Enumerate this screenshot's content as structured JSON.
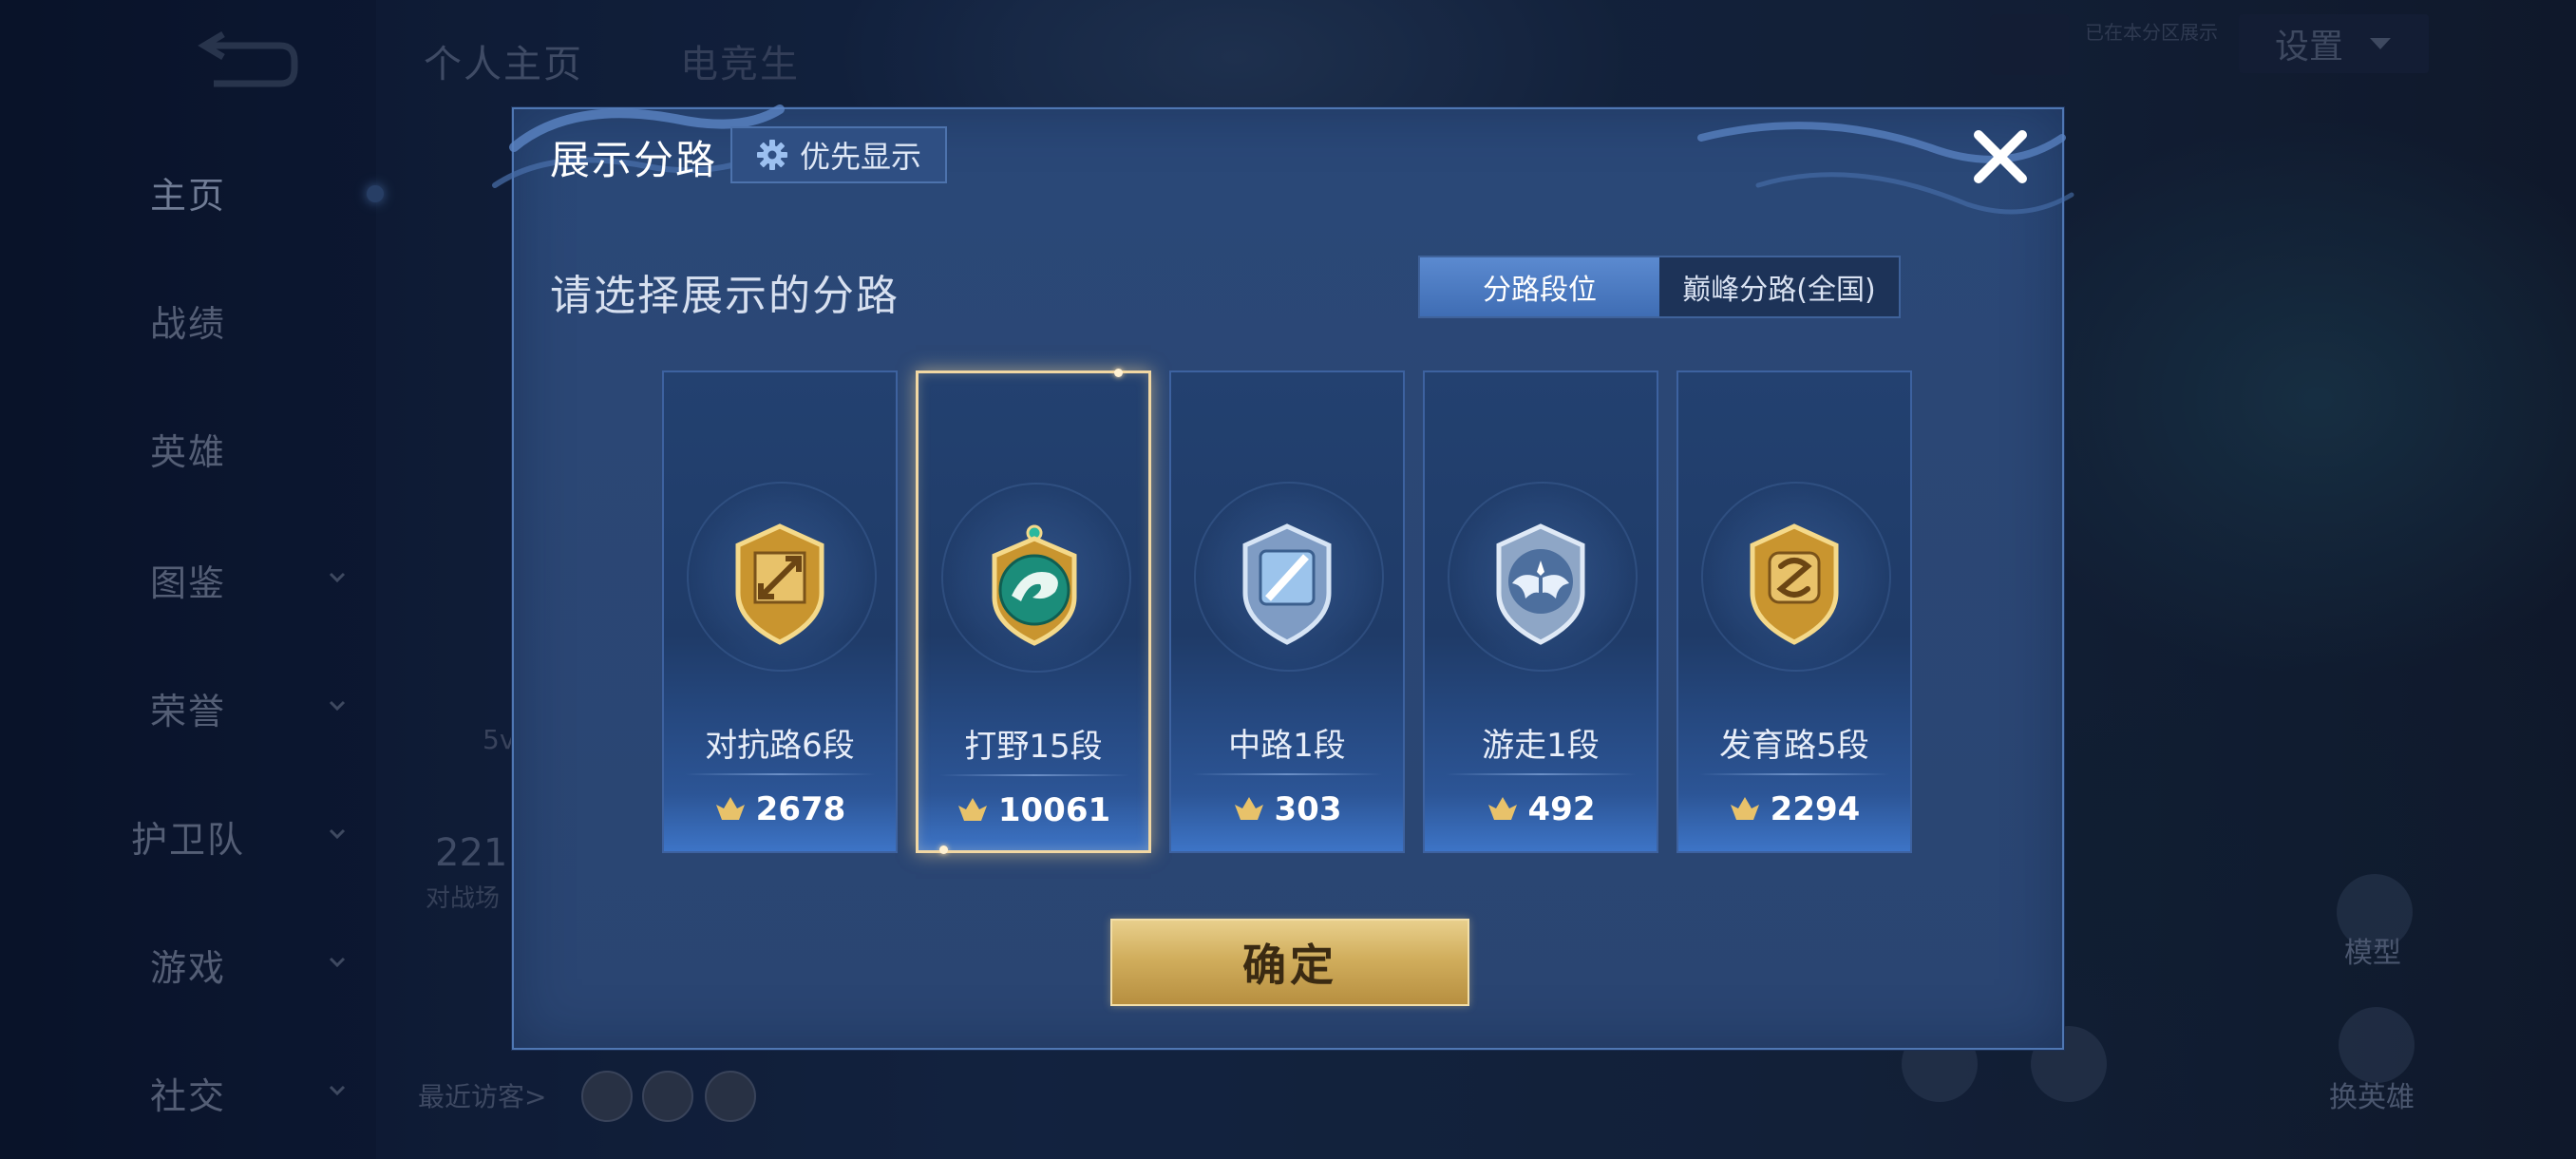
{
  "sidebar": {
    "items": [
      {
        "label": "主页"
      },
      {
        "label": "战绩"
      },
      {
        "label": "英雄"
      },
      {
        "label": "图鉴"
      },
      {
        "label": "荣誉"
      },
      {
        "label": "护卫队"
      },
      {
        "label": "游戏"
      },
      {
        "label": "社交"
      }
    ]
  },
  "background": {
    "tab_profile": "个人主页",
    "tab_esports": "电竞生",
    "stat_number": "221",
    "stat_label": "对战场",
    "partial_5v": "5v",
    "visitors_label": "最近访客>",
    "bell_hint": "已在本分区展示",
    "settings_label": "设置",
    "model_label": "模型",
    "switch_hero_label": "换英雄"
  },
  "dialog": {
    "title": "展示分路",
    "priority_button": "优先显示",
    "subtitle": "请选择展示的分路",
    "toggle": {
      "option_1": "分路段位",
      "option_2": "巅峰分路(全国)"
    },
    "lanes": [
      {
        "name": "对抗路6段",
        "score": "2678",
        "icon": "clash-lane-badge-icon",
        "color": "#e6b651"
      },
      {
        "name": "打野15段",
        "score": "10061",
        "icon": "jungle-dragon-badge-icon",
        "color": "#1f9a86"
      },
      {
        "name": "中路1段",
        "score": "303",
        "icon": "mid-lane-badge-icon",
        "color": "#6aa6de"
      },
      {
        "name": "游走1段",
        "score": "492",
        "icon": "roam-wings-badge-icon",
        "color": "#8fb0d8"
      },
      {
        "name": "发育路5段",
        "score": "2294",
        "icon": "farm-lane-badge-icon",
        "color": "#e6b651"
      }
    ],
    "selected_lane_index": 1,
    "confirm_button": "确定"
  }
}
